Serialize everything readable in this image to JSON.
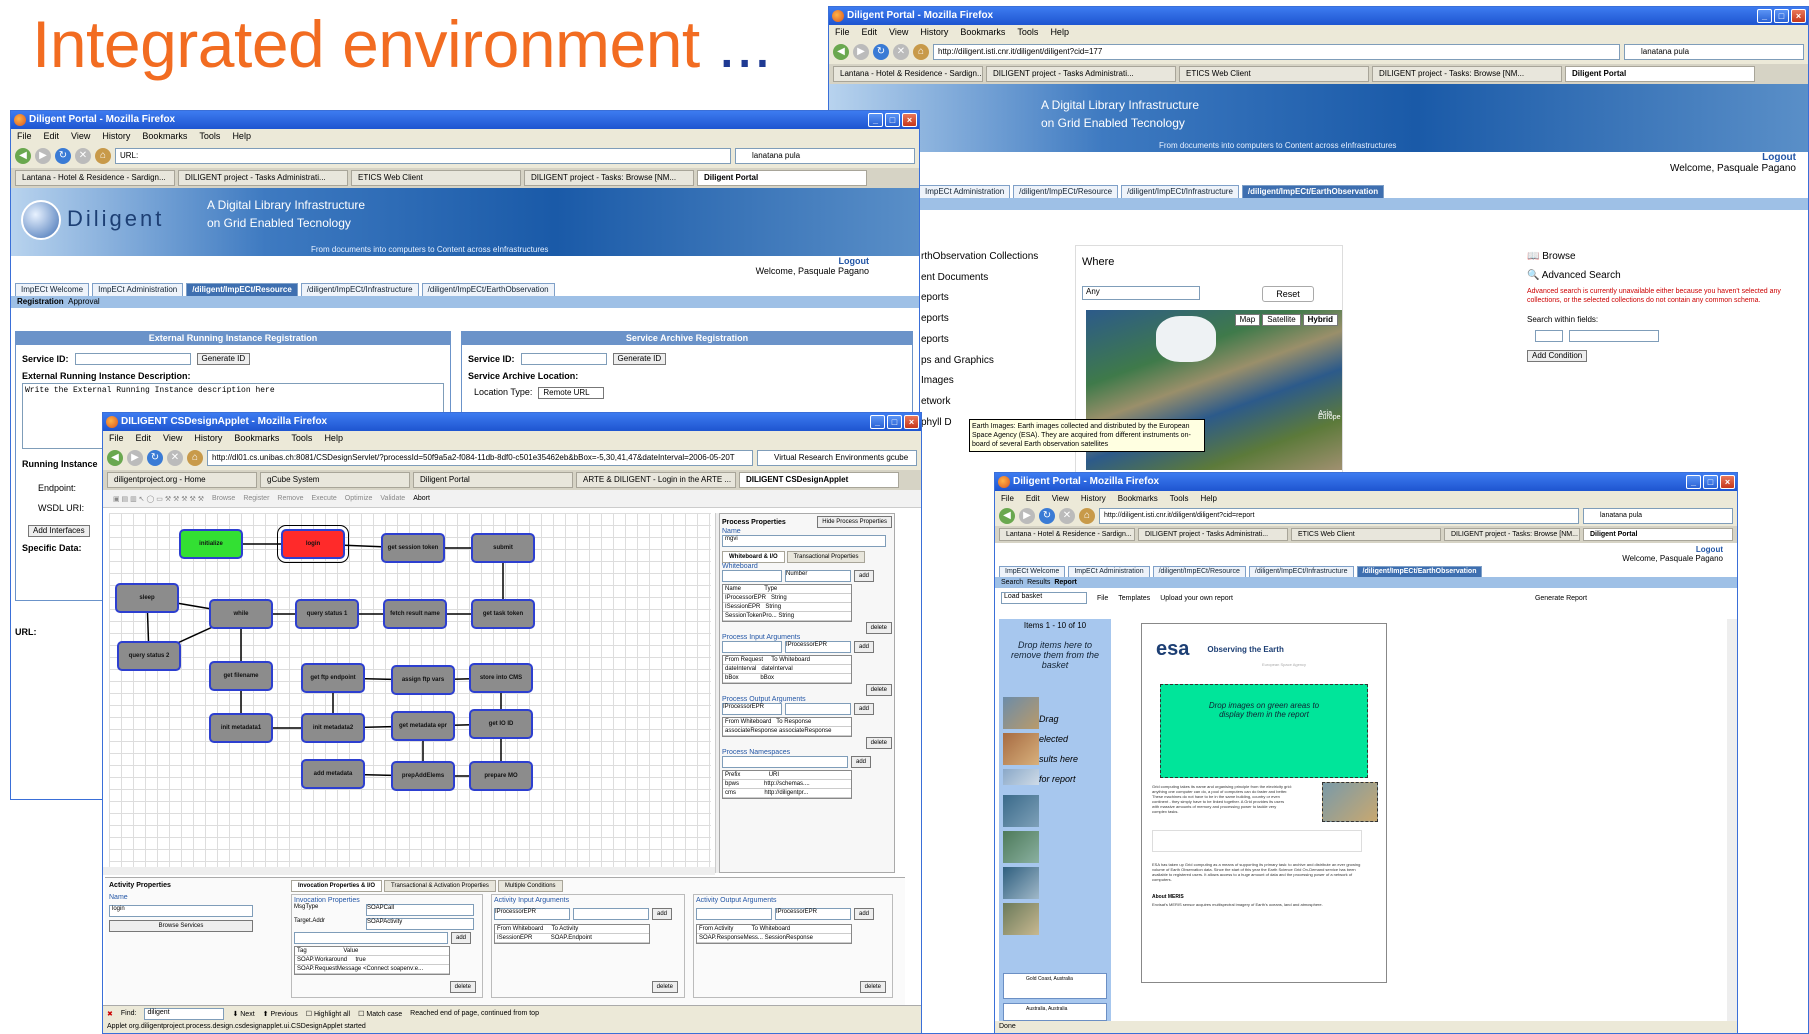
{
  "slide": {
    "title": "Integrated environment",
    "ellipsis": "..."
  },
  "browser": {
    "menu": [
      "File",
      "Edit",
      "View",
      "History",
      "Bookmarks",
      "Tools",
      "Help"
    ],
    "search_value": "lanatana pula"
  },
  "win_right": {
    "title": "Diligent Portal - Mozilla Firefox",
    "url": "http://diligent.isti.cnr.it/diligent/diligent?cid=177",
    "tabs": [
      "Lantana - Hotel & Residence - Sardign...",
      "DILIGENT project - Tasks Administrati...",
      "ETICS Web Client",
      "DILIGENT project - Tasks: Browse [NM...",
      "Diligent Portal"
    ],
    "banner_tag1": "A Digital Library Infrastructure",
    "banner_tag2": "on Grid Enabled Tecnology",
    "banner_tag3": "From documents into computers to Content across eInfrastructures",
    "logo_partial": "igent",
    "logout": "Logout",
    "welcome": "Welcome, Pasquale Pagano",
    "portal_tabs": [
      "ImpECt Administration",
      "/diligent/ImpECt/Resource",
      "/diligent/ImpECt/Infrastructure",
      "/diligent/ImpECt/EarthObservation"
    ],
    "subbar": "eport",
    "collections": [
      "rthObservation Collections",
      "ent Documents",
      "eports",
      "eports",
      "eports",
      "ps and Graphics",
      "Images",
      "etwork",
      "phyll D"
    ],
    "where_label": "Where",
    "where_select": "Any",
    "reset": "Reset",
    "map_buttons": [
      "Map",
      "Satellite",
      "Hybrid"
    ],
    "map_labels": [
      "Europe",
      "Asia",
      "Atlantic Ocean"
    ],
    "tooltip": "Earth Images: Earth images collected and distributed by the European Space Agency (ESA). They are acquired from different instruments on-board of several Earth observation satellites",
    "browse": "Browse",
    "advanced_search": "Advanced Search",
    "adv_warning": "Advanced search is currently unavailable either because you haven't selected any collections, or the selected collections do not contain any common schema.",
    "search_within": "Search within fields:",
    "add_condition": "Add Condition"
  },
  "win_left": {
    "title": "Diligent Portal - Mozilla Firefox",
    "url": "URL:",
    "tabs": [
      "Lantana - Hotel & Residence - Sardign...",
      "DILIGENT project - Tasks Administrati...",
      "ETICS Web Client",
      "DILIGENT project - Tasks: Browse [NM...",
      "Diligent Portal"
    ],
    "logo": "Diligent",
    "banner_tag1": "A Digital Library Infrastructure",
    "banner_tag2": "on Grid Enabled Tecnology",
    "banner_tag3": "From documents into computers to Content across eInfrastructures",
    "logout": "Logout",
    "welcome": "Welcome, Pasquale Pagano",
    "portal_tabs": [
      "ImpECt Welcome",
      "ImpECt Administration",
      "/diligent/ImpECt/Resource",
      "/diligent/ImpECt/Infrastructure",
      "/diligent/ImpECt/EarthObservation"
    ],
    "subtabs": [
      "Registration",
      "Approval"
    ],
    "panel1_title": "External Running Instance Registration",
    "panel2_title": "Service Archive Registration",
    "service_id": "Service ID:",
    "generate_id": "Generate ID",
    "eri_desc": "External Running Instance Description:",
    "eri_placeholder": "Write the External Running Instance description here",
    "sa_location": "Service Archive Location:",
    "location_type": "Location Type:",
    "location_value": "Remote URL",
    "running_instance": "Running Instance",
    "endpoint": "Endpoint:",
    "wsdl": "WSDL URI:",
    "add_interfaces": "Add Interfaces",
    "specific_data": "Specific Data:"
  },
  "win_cs": {
    "title": "DILIGENT CSDesignApplet - Mozilla Firefox",
    "url": "http://dl01.cs.unibas.ch:8081/CSDesignServlet/?processId=50f9a5a2-f084-11db-8df0-c501e35462eb&bBox=-5,30,41,47&dateInterval=2006-05-20T",
    "search": "Virtual Research Environments gcube",
    "tabs": [
      "diligentproject.org - Home",
      "gCube System",
      "Diligent Portal",
      "ARTE & DILIGENT - Login in the ARTE ...",
      "DILIGENT CSDesignApplet"
    ],
    "toolbar": [
      "Browse",
      "Register",
      "Remove",
      "Execute",
      "Optimize",
      "Validate",
      "Abort"
    ],
    "nodes": [
      "initialize",
      "login",
      "get session token",
      "submit",
      "sleep",
      "while",
      "query status 1",
      "fetch result name",
      "get task token",
      "query status 2",
      "get filename",
      "get ftp endpoint",
      "assign ftp vars",
      "store into CMS",
      "init metadata1",
      "init metadata2",
      "get metadata epr",
      "get IO ID",
      "add metadata",
      "prepAddElems",
      "prepare MO"
    ],
    "pp_title": "Process Properties",
    "hide_pp": "Hide Process Properties",
    "pp_name_label": "Name",
    "pp_name": "mgvi",
    "pp_tabs": [
      "Whiteboard & I/O",
      "Transactional Properties"
    ],
    "whiteboard": "Whiteboard",
    "number": "Number",
    "add": "add",
    "delete": "delete",
    "wb_cols": [
      "Name",
      "Type"
    ],
    "wb_rows": [
      [
        "IProcessorEPR",
        "String"
      ],
      [
        "ISessionEPR",
        "String"
      ],
      [
        "SessionTokenPro...",
        "String"
      ]
    ],
    "pia": "Process Input Arguments",
    "iproc": "IProcessorEPR",
    "pia_cols": [
      "From Request",
      "To Whiteboard"
    ],
    "pia_rows": [
      [
        "dateInterval",
        "dateInterval"
      ],
      [
        "bBox",
        "bBox"
      ]
    ],
    "poa": "Process Output Arguments",
    "poa_cols": [
      "From Whiteboard",
      "To Response"
    ],
    "poa_rows": [
      [
        "associateResponse",
        "associateResponse"
      ]
    ],
    "pns": "Process Namespaces",
    "pns_cols": [
      "Prefix",
      "URI"
    ],
    "pns_rows": [
      [
        "bpws",
        "http://schemas...."
      ],
      [
        "cms",
        "http://diligentpr..."
      ]
    ],
    "ap_title": "Activity Properties",
    "ap_name_label": "Name",
    "ap_name": "login",
    "browse_services": "Browse Services",
    "ap_tabs": [
      "Invocation Properties & I/O",
      "Transactional & Activation Properties",
      "Multiple Conditions"
    ],
    "inv_props": "Invocation Properties",
    "msgtype": "MsgType",
    "msgtype_val": "SOAPCall",
    "target": "Target.Addr",
    "target_val": "SOAPActivity",
    "inv_cols": [
      "Tag",
      "Value"
    ],
    "inv_rows": [
      [
        "SOAP.Workaround",
        "true"
      ],
      [
        "SOAP.RequestMessage",
        "<Connect soapenv:e..."
      ]
    ],
    "aia": "Activity Input Arguments",
    "aia_cols": [
      "From Whiteboard",
      "To Activity"
    ],
    "aia_rows": [
      [
        "ISessionEPR",
        "SOAP.Endpoint"
      ]
    ],
    "aoa": "Activity Output Arguments",
    "aoa_cols": [
      "From Activity",
      "To Whiteboard"
    ],
    "aoa_rows": [
      [
        "SOAP.ResponseMess...",
        "SessionResponse"
      ]
    ],
    "find_label": "Find:",
    "find_value": "diligent",
    "find_next": "Next",
    "find_prev": "Previous",
    "highlight": "Highlight all",
    "matchcase": "Match case",
    "find_status": "Reached end of page, continued from top",
    "status": "Applet org.diligentproject.process.design.csdesignapplet.ui.CSDesignApplet started"
  },
  "win_br": {
    "title": "Diligent Portal - Mozilla Firefox",
    "url": "http://diligent.isti.cnr.it/diligent/diligent?cid=report",
    "tabs": [
      "Lantana - Hotel & Residence - Sardign...",
      "DILIGENT project - Tasks Administrati...",
      "ETICS Web Client",
      "DILIGENT project - Tasks: Browse [NM...",
      "Diligent Portal"
    ],
    "logout": "Logout",
    "welcome": "Welcome, Pasquale Pagano",
    "portal_tabs": [
      "ImpECt Welcome",
      "ImpECt Administration",
      "/diligent/ImpECt/Resource",
      "/diligent/ImpECt/Infrastructure",
      "/diligent/ImpECt/EarthObservation"
    ],
    "subtabs": [
      "Search",
      "Results",
      "Report"
    ],
    "load_basket": "Load basket",
    "menu": [
      "File",
      "Templates",
      "Upload your own report"
    ],
    "generate": "Generate Report",
    "items": "Items 1 - 10 of 10",
    "drop_remove": "Drop items here to remove them from the basket",
    "drag_hint": [
      "Drag",
      "elected",
      "sults here",
      "for report"
    ],
    "thumb_labels": [
      "Gold Coast, Australia",
      "Australia, Australia"
    ],
    "esa": "esa",
    "obs_earth": "Observing the Earth",
    "esa_sub": "European Space Agency",
    "drop_green": "Drop images on green areas to display them in the report",
    "para1": "Grid computing takes its name and organising principle from the electricity grid: anything one computer can do, a pool of computers can do faster and better. These machines do not have to be in the same building, country or even continent - they simply have to be linked together. A Grid provides its users with massive amounts of memory and processing power to tackle very complex tasks.",
    "para2": "ESA has taken up Grid computing as a means of supporting its primary task: to archive and distribute an ever growing volume of Earth Observation data. Since the start of this year the Earth Science Grid On-Demand service has been available to registered users. It allows access to a huge amount of data and the processing power of a network of computers.",
    "about": "About MERIS",
    "para3": "Envisat's MERIS sensor acquires multispectral imagery of Earth's oceans, land and atmosphere.",
    "status": "Done"
  }
}
